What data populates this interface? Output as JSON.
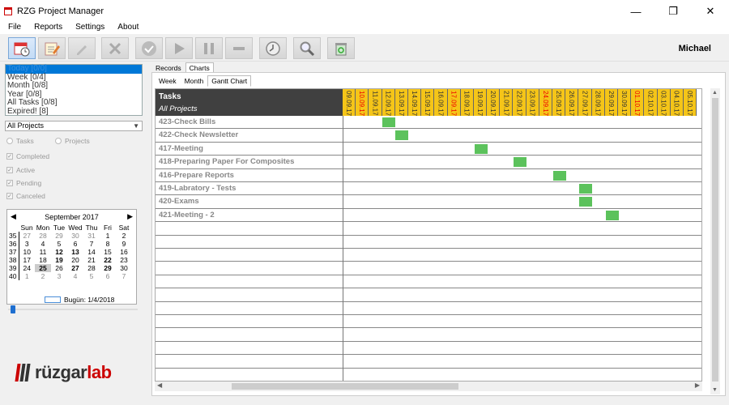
{
  "window": {
    "title": "RZG Project Manager",
    "minimize": "—",
    "maximize": "❐",
    "close": "✕"
  },
  "menu": [
    "File",
    "Reports",
    "Settings",
    "About"
  ],
  "user": "Michael",
  "filters": [
    "Today  [0/0]",
    "Week  [0/4]",
    "Month  [0/8]",
    "Year  [0/8]",
    "All Tasks  [0/8]",
    "Expired!  [8]"
  ],
  "project_combo": "All Projects",
  "view_radios": [
    "Tasks",
    "Projects"
  ],
  "status_checks": [
    "Completed",
    "Active",
    "Pending",
    "Canceled"
  ],
  "calendar": {
    "month": "September 2017",
    "days": [
      "Sun",
      "Mon",
      "Tue",
      "Wed",
      "Thu",
      "Fri",
      "Sat"
    ],
    "weeks": [
      {
        "wk": "35",
        "d": [
          "27",
          "28",
          "29",
          "30",
          "31",
          "1",
          "2"
        ]
      },
      {
        "wk": "36",
        "d": [
          "3",
          "4",
          "5",
          "6",
          "7",
          "8",
          "9"
        ]
      },
      {
        "wk": "37",
        "d": [
          "10",
          "11",
          "12",
          "13",
          "14",
          "15",
          "16"
        ]
      },
      {
        "wk": "38",
        "d": [
          "17",
          "18",
          "19",
          "20",
          "21",
          "22",
          "23"
        ]
      },
      {
        "wk": "39",
        "d": [
          "24",
          "25",
          "26",
          "27",
          "28",
          "29",
          "30"
        ]
      },
      {
        "wk": "40",
        "d": [
          "1",
          "2",
          "3",
          "4",
          "5",
          "6",
          "7"
        ]
      }
    ],
    "today_label": "Bugün: 1/4/2018"
  },
  "logo": {
    "part1": "rüzgar",
    "part2": "lab"
  },
  "tabs_main": [
    "Records",
    "Charts"
  ],
  "tabs_chart": [
    "Week",
    "Month",
    "Gantt Chart"
  ],
  "gantt": {
    "header": "Tasks",
    "subheader": "All Projects",
    "dates": [
      "09.09.17",
      "10.09.17",
      "11.09.17",
      "12.09.17",
      "13.09.17",
      "14.09.17",
      "15.09.17",
      "16.09.17",
      "17.09.17",
      "18.09.17",
      "19.09.17",
      "20.09.17",
      "21.09.17",
      "22.09.17",
      "23.09.17",
      "24.09.17",
      "25.09.17",
      "26.09.17",
      "27.09.17",
      "28.09.17",
      "29.09.17",
      "30.09.17",
      "01.10.17",
      "02.10.17",
      "03.10.17",
      "04.10.17",
      "05.10.17"
    ],
    "red_dates": [
      "10.09.17",
      "17.09.17",
      "24.09.17",
      "01.10.17"
    ],
    "tasks": [
      {
        "name": "423-Check Bills",
        "start": "12.09.17"
      },
      {
        "name": "422-Check Newsletter",
        "start": "13.09.17"
      },
      {
        "name": "417-Meeting",
        "start": "19.09.17"
      },
      {
        "name": "418-Preparing Paper For Composites",
        "start": "22.09.17"
      },
      {
        "name": "416-Prepare Reports",
        "start": "25.09.17"
      },
      {
        "name": "419-Labratory - Tests",
        "start": "27.09.17"
      },
      {
        "name": "420-Exams",
        "start": "27.09.17"
      },
      {
        "name": "421-Meeting - 2",
        "start": "29.09.17"
      }
    ],
    "empty_rows": 12
  }
}
